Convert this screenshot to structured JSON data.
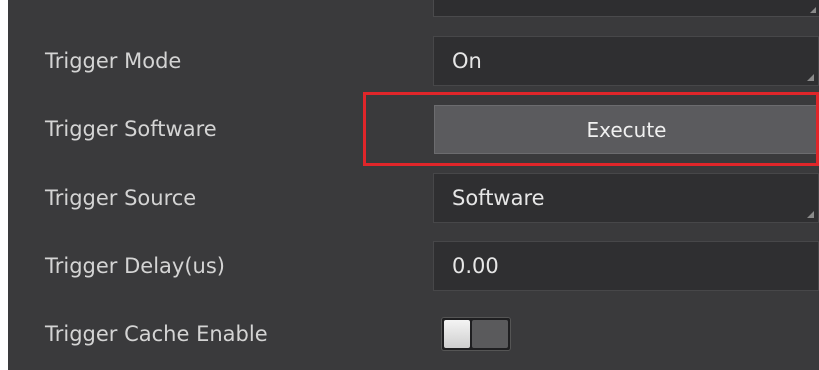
{
  "params": {
    "trigger_mode": {
      "label": "Trigger Mode",
      "value": "On"
    },
    "trigger_software": {
      "label": "Trigger Software",
      "button": "Execute"
    },
    "trigger_source": {
      "label": "Trigger Source",
      "value": "Software"
    },
    "trigger_delay": {
      "label": "Trigger Delay(us)",
      "value": "0.00"
    },
    "trigger_cache_enable": {
      "label": "Trigger Cache Enable",
      "enabled": false
    }
  },
  "colors": {
    "panel_bg": "#3a3a3c",
    "field_bg": "#2f2f31",
    "button_bg": "#5b5b5e",
    "highlight": "#e0262a"
  }
}
